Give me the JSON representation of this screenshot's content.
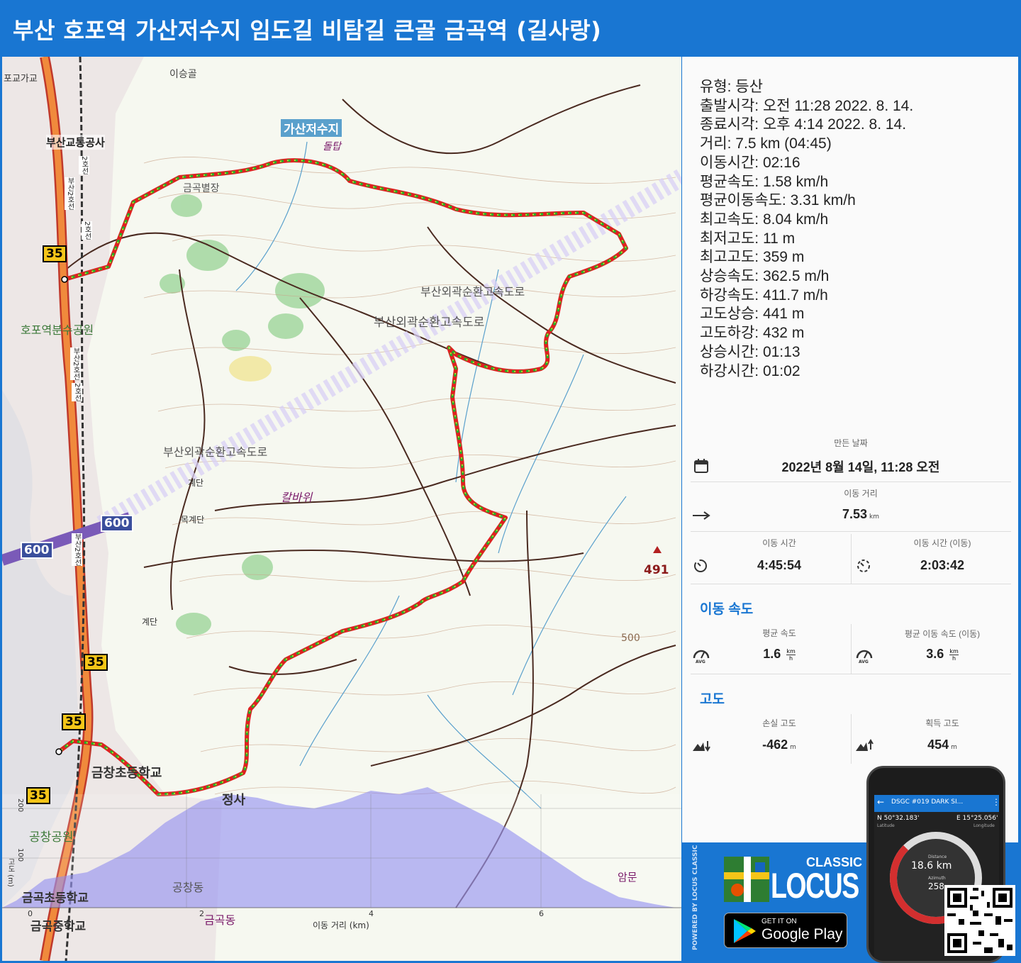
{
  "header": {
    "title": "부산 호포역 가산저수지 임도길 비탐길 큰골 금곡역 (길사랑)"
  },
  "stats": [
    "유형: 등산",
    "출발시각: 오전 11:28 2022. 8. 14.",
    "종료시각: 오후 4:14 2022. 8. 14.",
    "거리: 7.5 km (04:45)",
    "이동시간: 02:16",
    "평균속도: 1.58 km/h",
    "평균이동속도: 3.31 km/h",
    "최고속도: 8.04 km/h",
    "최저고도: 11 m",
    "최고고도: 359 m",
    "상승속도: 362.5 m/h",
    "하강속도: 411.7 m/h",
    "고도상승: 441 m",
    "고도하강: 432 m",
    "상승시간: 01:13",
    "하강시간: 01:02"
  ],
  "created": {
    "label": "만든 날짜",
    "value": "2022년 8월 14일, 11:28 오전"
  },
  "distance": {
    "label": "이동 거리",
    "value": "7.53",
    "unit": "km"
  },
  "time": {
    "total_label": "이동 시간",
    "total_value": "4:45:54",
    "moving_label": "이동 시간 (이동)",
    "moving_value": "2:03:42"
  },
  "speed": {
    "title": "이동 속도",
    "avg_label": "평균 속도",
    "avg_value": "1.6",
    "avg_moving_label": "평균 이동 속도 (이동)",
    "avg_moving_value": "3.6",
    "unit_top": "km",
    "unit_bottom": "h",
    "icon_avg": "AVG",
    "icon_avg_moving": "AVG"
  },
  "altitude": {
    "title": "고도",
    "loss_label": "손실 고도",
    "loss_value": "-462",
    "loss_unit": "m",
    "gain_label": "획득 고도",
    "gain_value": "454",
    "gain_unit": "m"
  },
  "map": {
    "labels": {
      "reservoir": "가산저수지",
      "dolttap": "돌탑",
      "igolgol": "이승골",
      "geumgokbyeoljang": "금곡별장",
      "busan_transit": "부산교통공사",
      "hopo_park": "호포역분수공원",
      "expressway1": "부산외곽순환고속도로",
      "expressway2": "부산외곽순환고속도로",
      "expressway3": "부산외곽순환고속도로",
      "kalbawi": "칼바위",
      "gyedan1": "계단",
      "mokgyedan": "목계단",
      "gyedan2": "계단",
      "geumchang_school": "금창초등학교",
      "temple": "정사",
      "gongchang_park": "공창공원",
      "gongchang_dong": "공창동",
      "geumgok_elementary": "금곡초등학교",
      "geumgok_middle": "금곡중학교",
      "geumgok_dong": "금곡동",
      "ammun": "암문",
      "bridge": "포교가교",
      "line2a": "2호선",
      "line2b": "부산2호선",
      "line2c": "2호선",
      "line2d": "부산2호선",
      "line2e": "2호선",
      "line2f": "부산2호선",
      "peak491": "491",
      "contour500": "500",
      "road35a": "35",
      "road35b": "35",
      "road35c": "35",
      "road35d": "35",
      "road600a": "600",
      "road600b": "600",
      "chart_xlabel": "이동 거리 (km)",
      "chart_x0": "0",
      "chart_x2": "2",
      "chart_x4": "4",
      "chart_x6": "6",
      "chart_y100": "100",
      "chart_y200": "200",
      "chart_ylabel": "고도 (m)"
    }
  },
  "promo": {
    "powered": "POWERED BY LOCUS CLASSIC",
    "classic": "CLASSIC",
    "locus": "LOCUS",
    "getiton": "GET IT ON",
    "googleplay": "Google Play",
    "phone_title": "DSGC #019 DARK SI...",
    "phone_lat": "N 50°32.183'",
    "phone_lat_label": "Latitude",
    "phone_lon": "E 15°25.056'",
    "phone_lon_label": "Longitude",
    "phone_distance_label": "Distance",
    "phone_distance": "18.6 km",
    "phone_azimuth_label": "Azimuth",
    "phone_azimuth": "258"
  },
  "colors": {
    "brand_blue": "#1976d2",
    "track_green": "#22b02c",
    "track_red": "#e02020",
    "track_yellow": "#f0e020",
    "elevation_fill": "#8f8cf0"
  }
}
